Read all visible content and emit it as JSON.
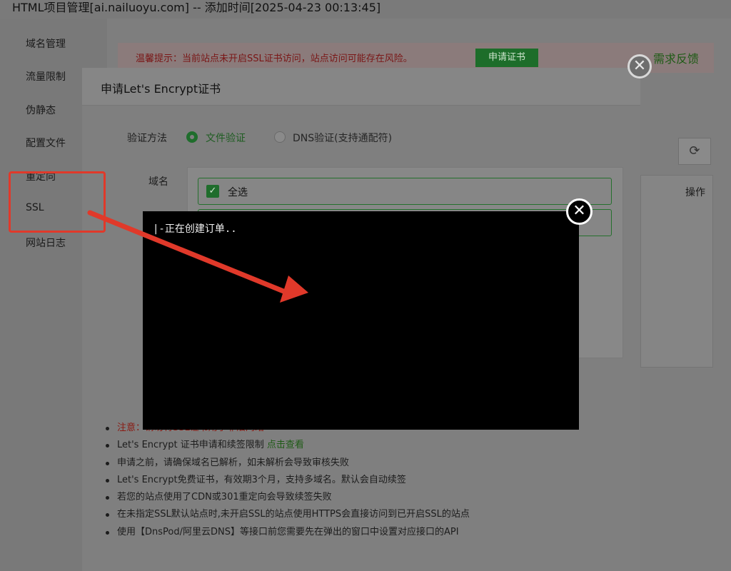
{
  "window_title": "HTML项目管理[ai.nailuoyu.com] -- 添加时间[2025-04-23 00:13:45]",
  "sidebar": {
    "items": [
      {
        "label": "域名管理"
      },
      {
        "label": "流量限制"
      },
      {
        "label": "伪静态"
      },
      {
        "label": "配置文件"
      },
      {
        "label": "重定向"
      },
      {
        "label": "SSL"
      },
      {
        "label": "网站日志"
      }
    ]
  },
  "background": {
    "warning_text": "温馨提示：当前站点未开启SSL证书访问，站点访问可能存在风险。",
    "apply_button": "申请证书",
    "feedback": "需求反馈",
    "table_header_op": "操作"
  },
  "dialog": {
    "title": "申请Let's Encrypt证书",
    "verify_label": "验证方法",
    "option_file": "文件验证",
    "option_dns": "DNS验证(支持通配符)",
    "domain_label": "域名",
    "select_all": "全选",
    "notes": {
      "n0_prefix": "注意：",
      "n0_text": "请勿将SSL证书用于非法网站",
      "n1_text": "Let's Encrypt 证书申请和续签限制 ",
      "n1_link": "点击查看",
      "n2": "申请之前，请确保域名已解析，如未解析会导致审核失败",
      "n3": "Let's Encrypt免费证书，有效期3个月，支持多域名。默认会自动续签",
      "n4": "若您的站点使用了CDN或301重定向会导致续签失败",
      "n5": "在未指定SSL默认站点时,未开启SSL的站点使用HTTPS会直接访问到已开启SSL的站点",
      "n6": "使用【DnsPod/阿里云DNS】等接口前您需要先在弹出的窗口中设置对应接口的API"
    }
  },
  "terminal": {
    "text": "|-正在创建订单.."
  },
  "annotation": {
    "color": "#e0392a"
  },
  "colors": {
    "accent_green": "#20a53a",
    "overlay": "#000000"
  }
}
